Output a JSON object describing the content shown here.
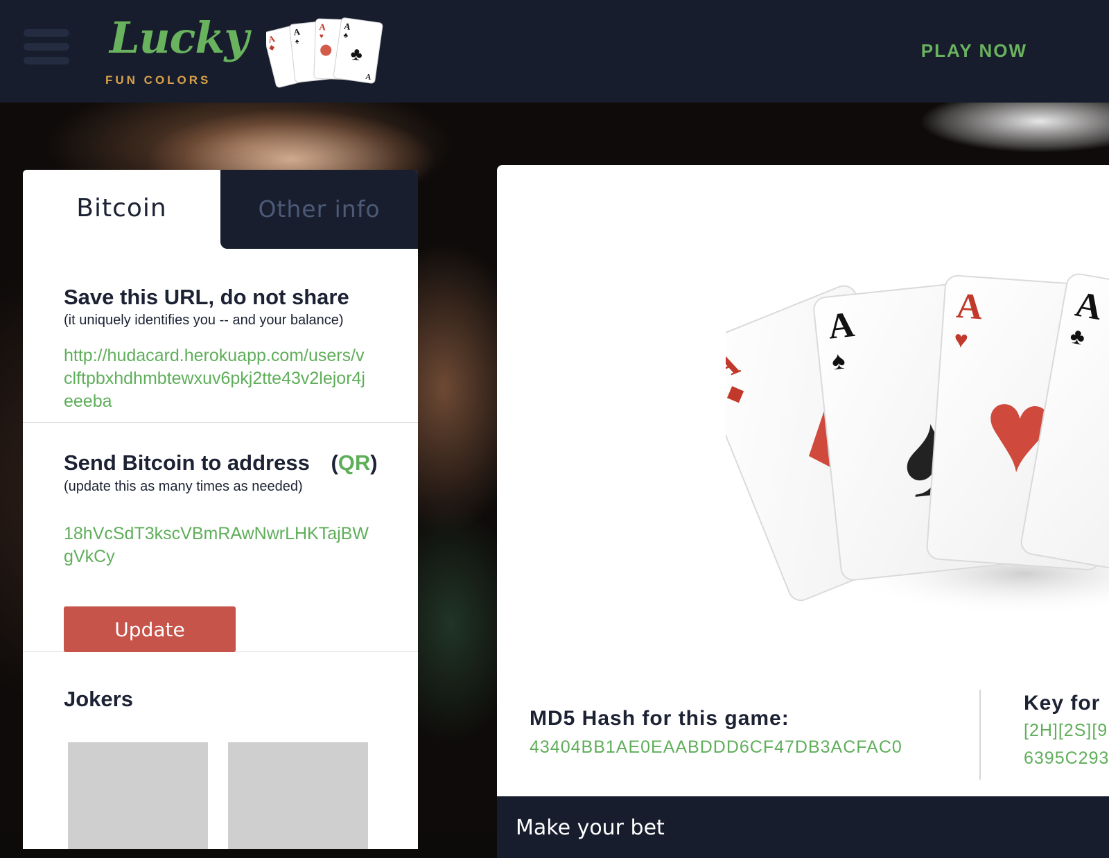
{
  "header": {
    "logo_word": "Lucky",
    "logo_sub": "FUN COLORS",
    "play_now": "PLAY NOW"
  },
  "tabs": {
    "bitcoin": "Bitcoin",
    "other": "Other info"
  },
  "url_section": {
    "title": "Save this URL, do not share",
    "subtitle": "(it uniquely identifies you -- and your balance)",
    "url": "http://hudacard.herokuapp.com/users/vclftpbxhdhmbtewxuv6pkj2tte43v2lejor4jeeeba"
  },
  "address_section": {
    "title": "Send Bitcoin to address",
    "qr_open": "(",
    "qr_label": "QR",
    "qr_close": ")",
    "subtitle": "(update this as many times as needed)",
    "address": "18hVcSdT3kscVBmRAwNwrLHKTajBWgVkCy",
    "update_label": "Update"
  },
  "jokers": {
    "title": "Jokers"
  },
  "game": {
    "hash_label": "MD5 Hash for this game:",
    "hash_value": "43404BB1AE0EAABDDD6CF47DB3ACFAC0",
    "key_label": "Key for",
    "key_line1": "[2H][2S][9",
    "key_line2": "6395C293"
  },
  "bet": {
    "label": "Make your bet"
  },
  "colors": {
    "header_bg": "#171d2c",
    "accent_green": "#5fae5a",
    "update_red": "#c6544a",
    "logo_gold": "#d8a24a"
  },
  "icons": {
    "menu": "hamburger-menu-icon",
    "logo_cards": "four-aces-cards-icon",
    "hero_cards": "four-aces-cards-illustration"
  }
}
